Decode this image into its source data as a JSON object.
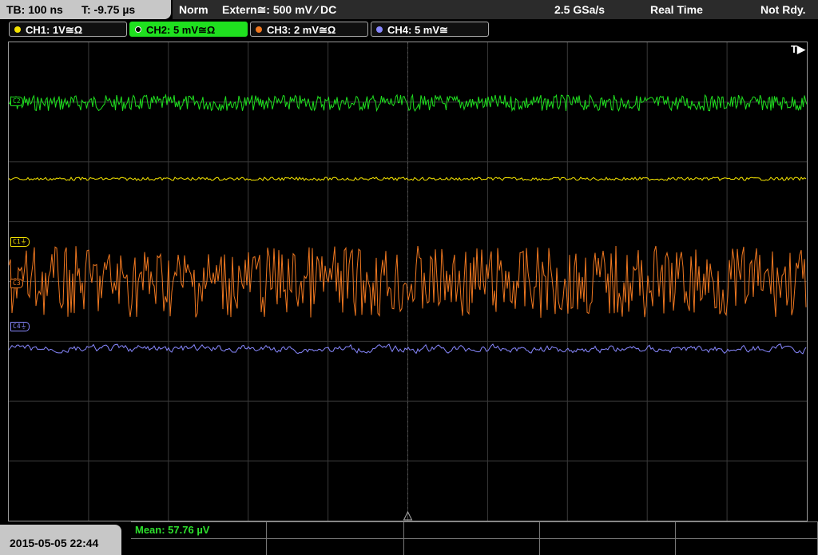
{
  "topbar": {
    "timebase": "TB: 100 ns",
    "trigger_time": "T: -9.75 µs",
    "mode": "Norm",
    "trigger_source": "Extern≅: 500 mV ⁄ DC",
    "sample_rate": "2.5 GSa/s",
    "acq_mode": "Real Time",
    "status": "Not Rdy."
  },
  "channels": [
    {
      "label": "CH1: 1V≅Ω",
      "color": "#f5e400",
      "active": false
    },
    {
      "label": "CH2: 5 mV≅Ω",
      "color": "#1fe01f",
      "active": true
    },
    {
      "label": "CH3: 2 mV≅Ω",
      "color": "#f07820",
      "active": false
    },
    {
      "label": "CH4: 5 mV≅",
      "color": "#8888ff",
      "active": false
    }
  ],
  "trace_markers": {
    "c1": "C1⏚",
    "c2": "C2",
    "c3": "C3",
    "c4": "C4⏚"
  },
  "trigger_indicator": "T▶",
  "footer": {
    "datetime": "2015-05-05 22:44",
    "measurement": "Mean: 57.76 µV"
  },
  "colors": {
    "ch1": "#f5e400",
    "ch2": "#1fe01f",
    "ch3": "#f07820",
    "ch4": "#8888ff",
    "grid": "#3a3a3a"
  }
}
